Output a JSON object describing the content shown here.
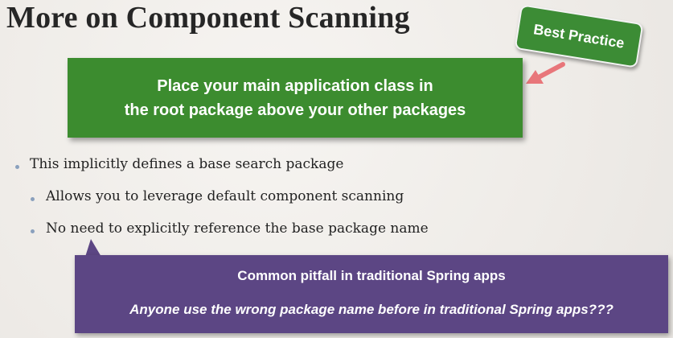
{
  "slide": {
    "title": "More on Component Scanning",
    "badge": "Best Practice",
    "green_box": {
      "line1": "Place your main application class in",
      "line2": "the root package above your other packages"
    },
    "bullets": [
      "This implicitly defines a base search package",
      "Allows you to leverage default component scanning",
      "No need to explicitly reference the base package name"
    ],
    "purple_box": {
      "heading": "Common pitfall in traditional Spring apps",
      "question": "Anyone use the wrong package name before in traditional Spring apps???"
    },
    "colors": {
      "green": "#3c8c2f",
      "purple": "#5c4684",
      "arrow": "#e8767a",
      "bullet": "#8aa0bd"
    }
  }
}
